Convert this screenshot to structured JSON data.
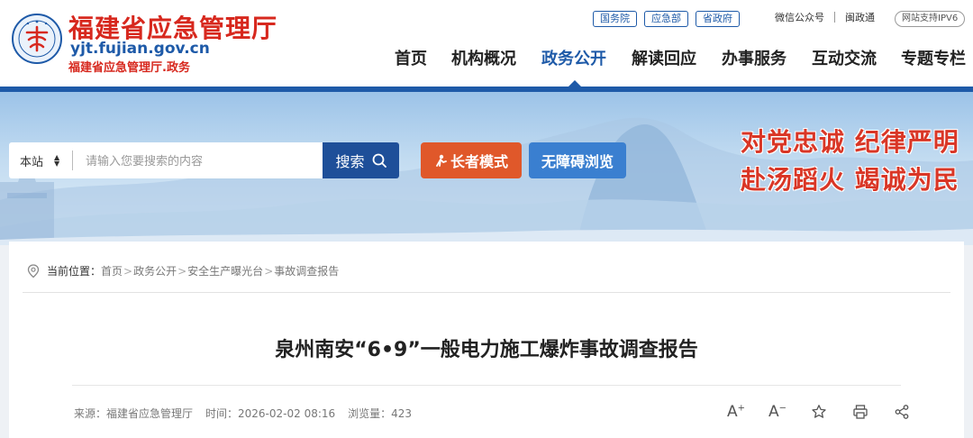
{
  "header": {
    "site_name": "福建省应急管理厅",
    "domain": "yjt.fujian.gov.cn",
    "subtitle": "福建省应急管理厅.政务",
    "top_links": [
      "国务院",
      "应急部",
      "省政府"
    ],
    "wechat": "微信公众号",
    "mingzhengtong": "闽政通",
    "ipv6": "网站支持IPV6",
    "nav": [
      "首页",
      "机构概况",
      "政务公开",
      "解读回应",
      "办事服务",
      "互动交流",
      "专题专栏"
    ],
    "nav_active_index": 2,
    "accent_color": "#1e5aa8",
    "brand_red": "#d7281e"
  },
  "banner": {
    "search_scope": "本站",
    "search_placeholder": "请输入您要搜索的内容",
    "search_button": "搜索",
    "elder_mode": "长者模式",
    "accessible": "无障碍浏览",
    "slogan_line1": "对党忠诚  纪律严明",
    "slogan_line2": "赴汤蹈火  竭诚为民"
  },
  "breadcrumb": {
    "label": "当前位置：",
    "items": [
      "首页",
      "政务公开",
      "安全生产曝光台",
      "事故调查报告"
    ]
  },
  "article": {
    "title": "泉州南安“6•9”一般电力施工爆炸事故调查报告",
    "source": "来源：福建省应急管理厅",
    "time": "时间：2026-02-02 08:16",
    "views": "浏览量：423"
  },
  "tools": {
    "font_larger": "A",
    "font_smaller": "A"
  }
}
